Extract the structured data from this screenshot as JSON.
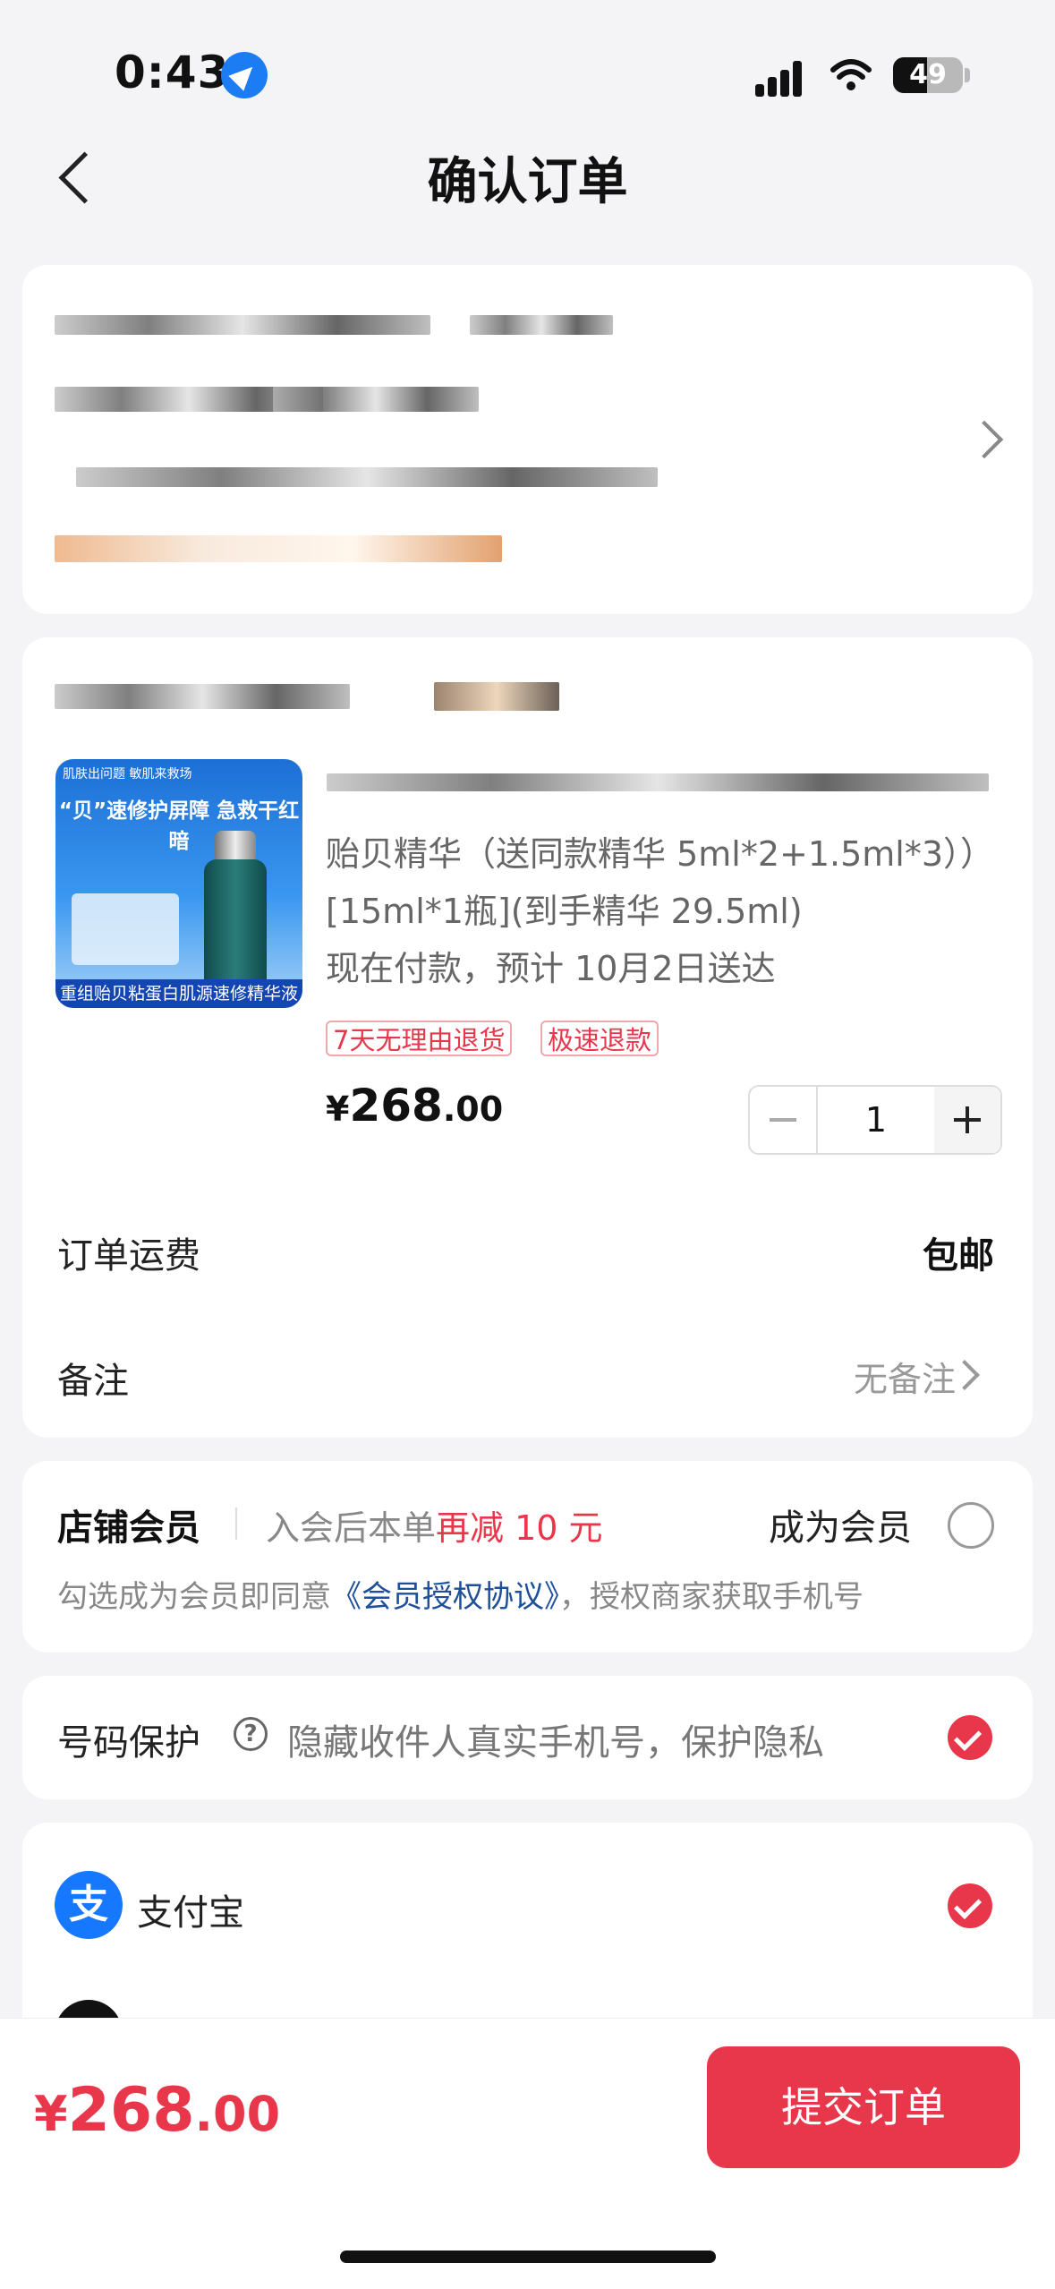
{
  "status_bar": {
    "time": "0:43",
    "battery": "49"
  },
  "header": {
    "title": "确认订单"
  },
  "product": {
    "image_top_text": "肌肤出问题 敏肌来救场",
    "image_headline": "“贝”速修护屏障 急救干红暗",
    "image_band_text": "重组贻贝粘蛋白肌源速修精华液",
    "description": "贻贝精华（送同款精华 5ml*2+1.5ml*3））[15ml*1瓶](到手精华 29.5ml)",
    "delivery": "现在付款，预计 10月2日送达",
    "tags": [
      "7天无理由退货",
      "极速退款"
    ],
    "price_symbol": "¥",
    "price_int": "268",
    "price_dec": ".00",
    "quantity": "1"
  },
  "shipping": {
    "label": "订单运费",
    "value": "包邮"
  },
  "remark": {
    "label": "备注",
    "value": "无备注"
  },
  "membership": {
    "title": "店铺会员",
    "promo_prefix": "入会后本单",
    "promo_highlight": "再减 10 元",
    "join_label": "成为会员",
    "agree_prefix": "勾选成为会员即同意",
    "agreement_link": "《会员授权协议》",
    "agree_suffix": "，授权商家获取手机号"
  },
  "privacy": {
    "label": "号码保护",
    "desc": "隐藏收件人真实手机号，保护隐私"
  },
  "payment": {
    "method": "支付宝"
  },
  "footer": {
    "total_symbol": "¥",
    "total_int": "268",
    "total_dec": ".00",
    "submit_label": "提交订单"
  },
  "colors": {
    "accent": "#e8374b",
    "link": "#1d4f9a",
    "alipay": "#1677ff"
  }
}
